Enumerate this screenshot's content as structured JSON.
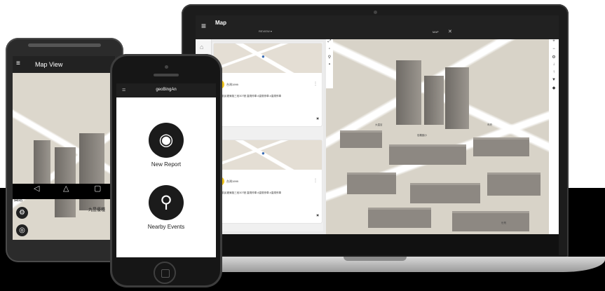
{
  "laptop": {
    "app_title": "Map",
    "nav_title": "REVIEW ▾",
    "tab_label": "MAP",
    "posts": [
      {
        "user": "台灣1999",
        "text": "中正區民權東路三段307號 違規停車 #違規停車 #違規停車",
        "comments": "0"
      },
      {
        "user": "台灣1999",
        "text": "中正區民權東路三段307號 違規停車 #違規停車 #違規停車",
        "comments": "0"
      }
    ],
    "map_labels": [
      "大遠百",
      "信義國小",
      "市府",
      "世貿"
    ]
  },
  "android": {
    "title": "Map View",
    "labels": [
      "九昱優種",
      "園站"
    ]
  },
  "iphone": {
    "title": "geoBingAn",
    "new_report_label": "New Report",
    "nearby_events_label": "Nearby Events"
  },
  "icons": [
    "menu-icon",
    "camera-icon",
    "location-pin-icon",
    "settings-icon",
    "crosshair-icon",
    "home-icon",
    "comment-icon",
    "person-icon"
  ],
  "colors": {
    "appbar": "#212121",
    "button": "#1b1b1b",
    "map_base": "#d8d3c8",
    "avatar": "#f0c419"
  }
}
